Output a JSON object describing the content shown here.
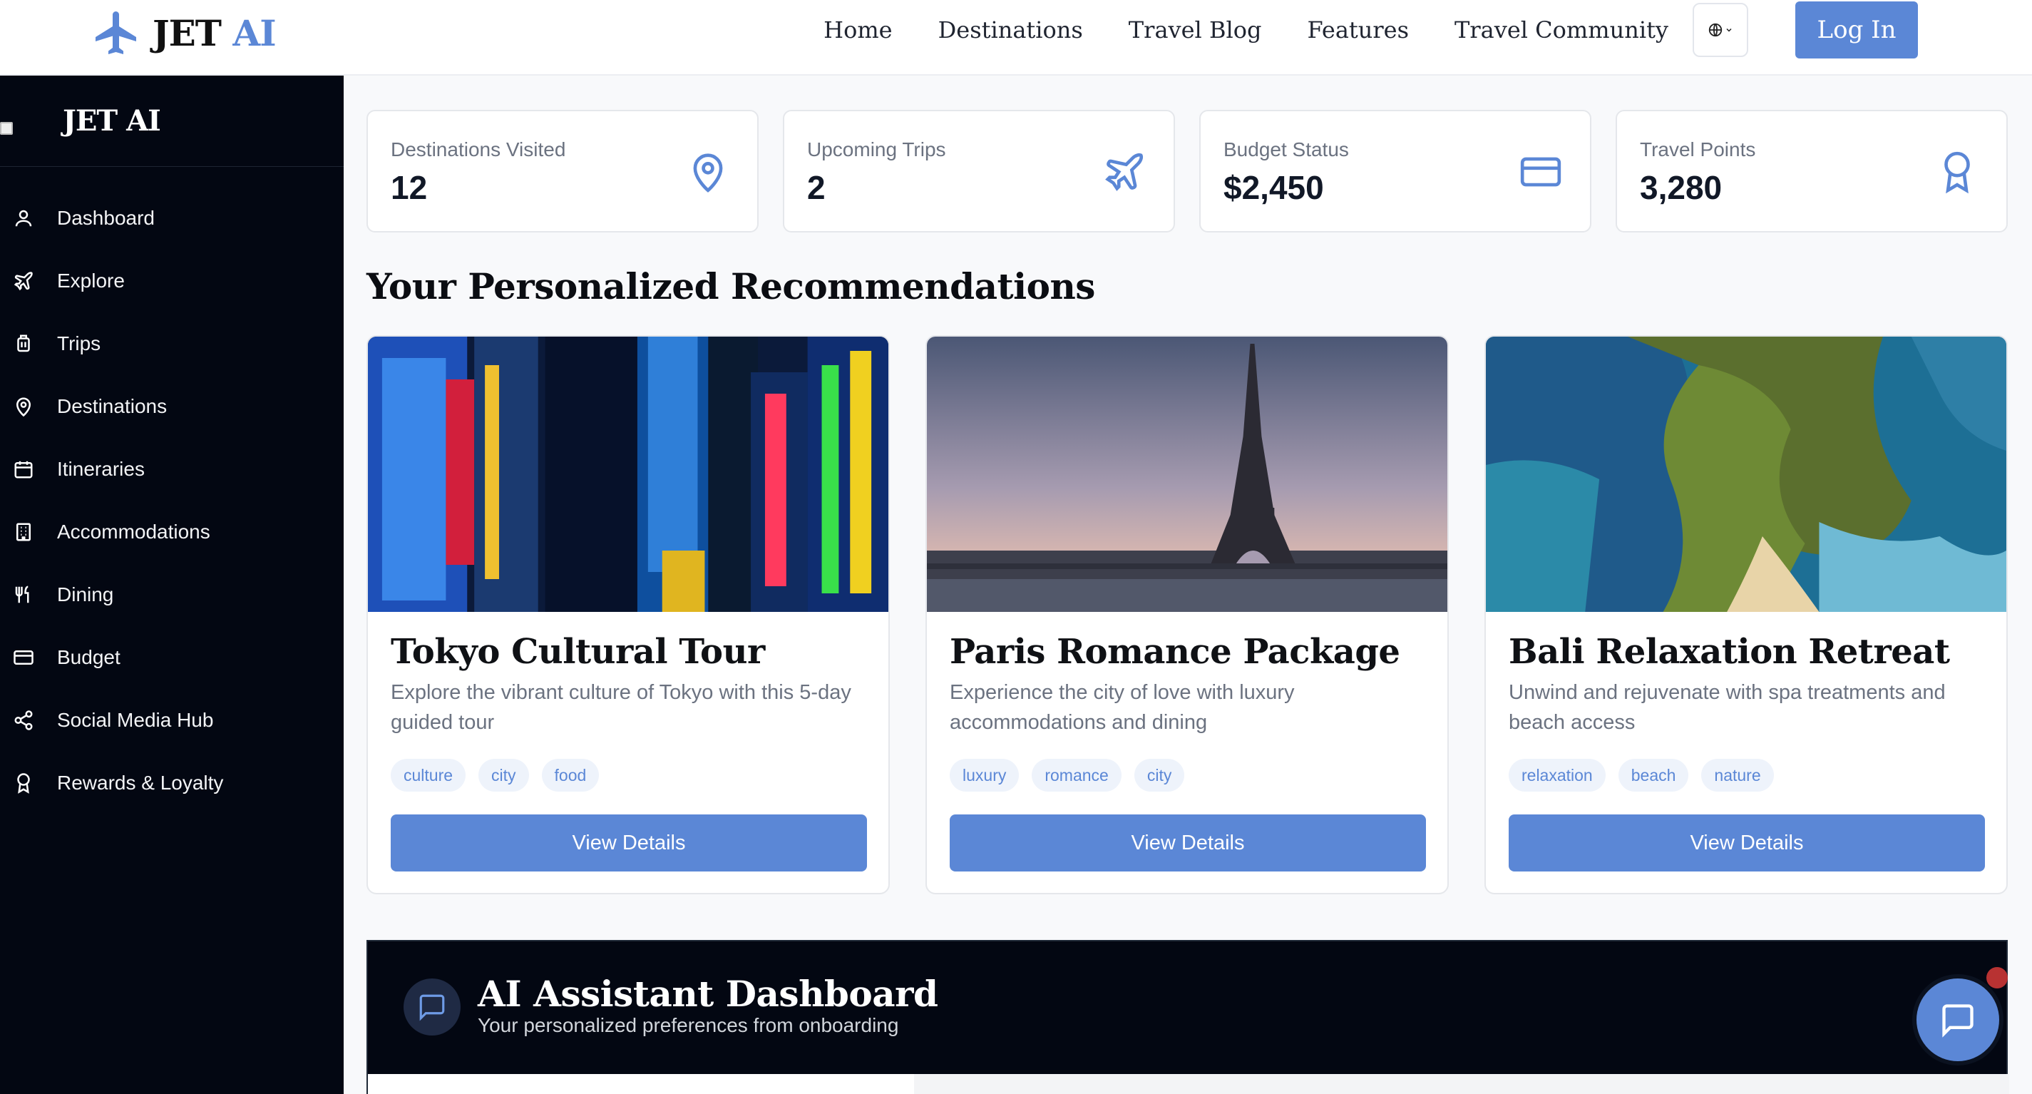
{
  "brand": {
    "name_part1": "JET",
    "name_part2": "AI",
    "sidebar_name": "JET AI",
    "broken_img_alt": "JET"
  },
  "nav": {
    "links": [
      "Home",
      "Destinations",
      "Travel Blog",
      "Features",
      "Travel Community"
    ],
    "lang_icon": "globe-icon",
    "login_label": "Log In"
  },
  "sidebar": {
    "items": [
      {
        "label": "Dashboard",
        "icon": "user-icon"
      },
      {
        "label": "Explore",
        "icon": "plane-icon"
      },
      {
        "label": "Trips",
        "icon": "luggage-icon"
      },
      {
        "label": "Destinations",
        "icon": "map-pin-icon"
      },
      {
        "label": "Itineraries",
        "icon": "calendar-icon"
      },
      {
        "label": "Accommodations",
        "icon": "building-icon"
      },
      {
        "label": "Dining",
        "icon": "utensils-icon"
      },
      {
        "label": "Budget",
        "icon": "credit-card-icon"
      },
      {
        "label": "Social Media Hub",
        "icon": "share-icon"
      },
      {
        "label": "Rewards & Loyalty",
        "icon": "award-icon"
      }
    ]
  },
  "stats": [
    {
      "label": "Destinations Visited",
      "value": "12",
      "icon": "map-pin-icon"
    },
    {
      "label": "Upcoming Trips",
      "value": "2",
      "icon": "plane-icon"
    },
    {
      "label": "Budget Status",
      "value": "$2,450",
      "icon": "credit-card-icon"
    },
    {
      "label": "Travel Points",
      "value": "3,280",
      "icon": "award-icon"
    }
  ],
  "recommendations": {
    "title": "Your Personalized Recommendations",
    "cards": [
      {
        "title": "Tokyo Cultural Tour",
        "description": "Explore the vibrant culture of Tokyo with this 5-day guided tour",
        "tags": [
          "culture",
          "city",
          "food"
        ],
        "button": "View Details",
        "image": "tokyo-street-image"
      },
      {
        "title": "Paris Romance Package",
        "description": "Experience the city of love with luxury accommodations and dining",
        "tags": [
          "luxury",
          "romance",
          "city"
        ],
        "button": "View Details",
        "image": "paris-eiffel-image"
      },
      {
        "title": "Bali Relaxation Retreat",
        "description": "Unwind and rejuvenate with spa treatments and beach access",
        "tags": [
          "relaxation",
          "beach",
          "nature"
        ],
        "button": "View Details",
        "image": "bali-coast-image"
      }
    ]
  },
  "ai_assistant": {
    "title": "AI Assistant Dashboard",
    "subtitle": "Your personalized preferences from onboarding",
    "icon": "message-icon"
  },
  "chat_fab": {
    "icon": "message-icon",
    "badge_color": "#b83232"
  },
  "colors": {
    "accent": "#5b87d6",
    "sidebar_bg": "#030712",
    "page_bg": "#f8f9fb"
  }
}
